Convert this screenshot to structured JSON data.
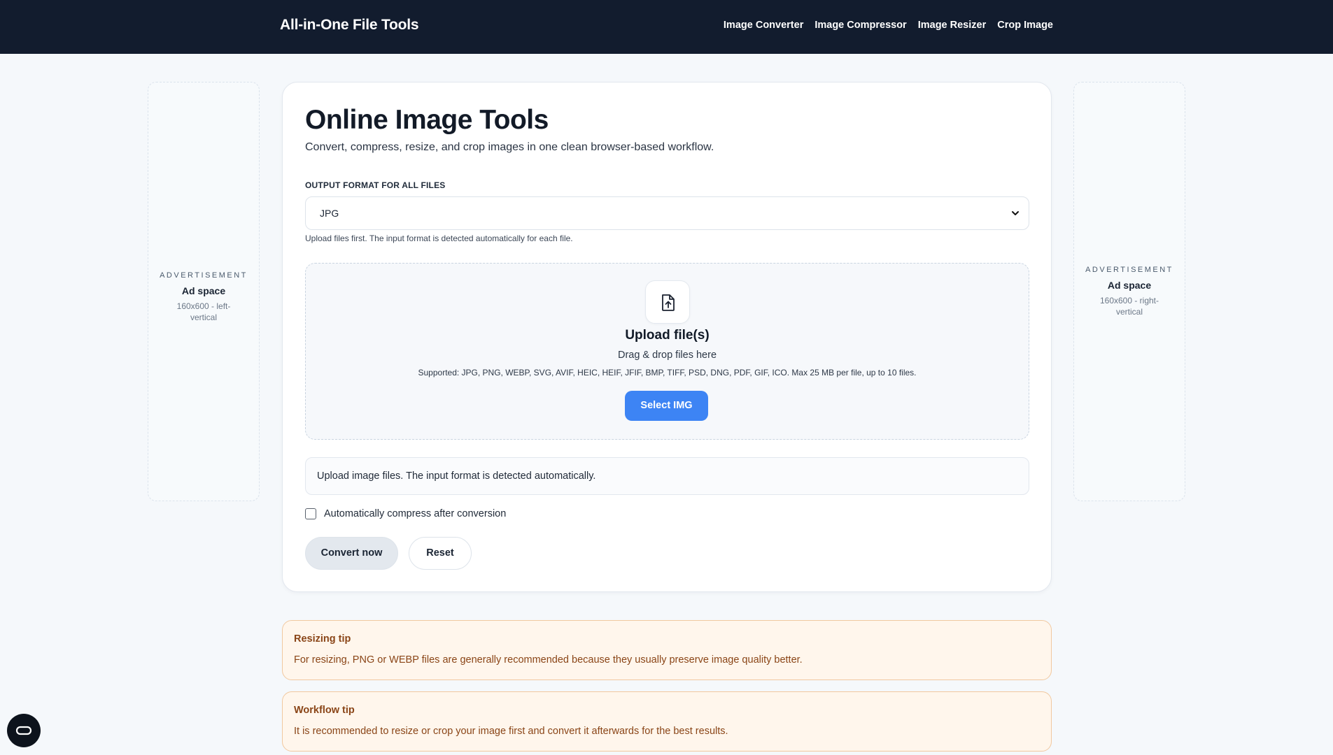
{
  "header": {
    "brand": "All-in-One File Tools",
    "nav": [
      "Image Converter",
      "Image Compressor",
      "Image Resizer",
      "Crop Image"
    ]
  },
  "ads": {
    "left": {
      "tag": "ADVERTISEMENT",
      "title": "Ad space",
      "size": "160x600 - left-vertical"
    },
    "right": {
      "tag": "ADVERTISEMENT",
      "title": "Ad space",
      "size": "160x600 - right-vertical"
    }
  },
  "main": {
    "title": "Online Image Tools",
    "subtitle": "Convert, compress, resize, and crop images in one clean browser-based workflow.",
    "format_label": "OUTPUT FORMAT FOR ALL FILES",
    "format_value": "JPG",
    "format_hint": "Upload files first. The input format is detected automatically for each file.",
    "dropzone": {
      "icon": "file-upload-icon",
      "title": "Upload file(s)",
      "subtitle": "Drag & drop files here",
      "supported": "Supported: JPG, PNG, WEBP, SVG, AVIF, HEIC, HEIF, JFIF, BMP, TIFF, PSD, DNG, PDF, GIF, ICO. Max 25 MB per file, up to 10 files.",
      "button": "Select IMG"
    },
    "status": "Upload image files. The input format is detected automatically.",
    "auto_compress_label": "Automatically compress after conversion",
    "auto_compress_checked": false,
    "convert_button": "Convert now",
    "reset_button": "Reset"
  },
  "tips": [
    {
      "title": "Resizing tip",
      "text": "For resizing, PNG or WEBP files are generally recommended because they usually preserve image quality better."
    },
    {
      "title": "Workflow tip",
      "text": "It is recommended to resize or crop your image first and convert it afterwards for the best results."
    }
  ],
  "colors": {
    "header_bg": "#121c2e",
    "accent": "#3d84f4",
    "tip_bg": "#fff6ec",
    "tip_border": "#f1c89f",
    "tip_text": "#8a4517"
  }
}
